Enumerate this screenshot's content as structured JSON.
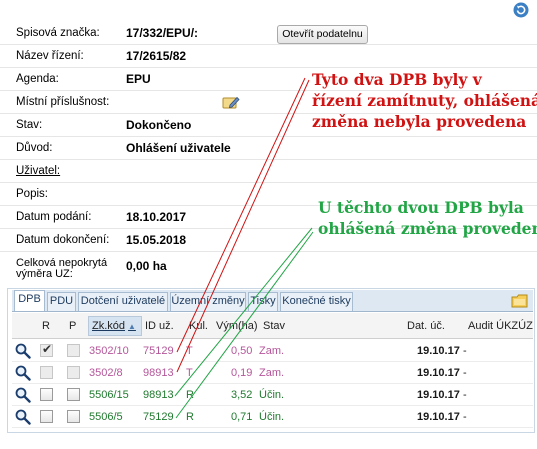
{
  "form": {
    "spisova_znacka": {
      "label": "Spisová značka:",
      "value": "17/332/EPU/:"
    },
    "open_button": "Otevřít podatelnu",
    "nazev_rizeni": {
      "label": "Název řízení:",
      "value": "17/2615/82"
    },
    "agenda": {
      "label": "Agenda:",
      "value": "EPU"
    },
    "mistni_prislusnost": {
      "label": "Místní příslušnost:",
      "value": ""
    },
    "stav": {
      "label": "Stav:",
      "value": "Dokončeno"
    },
    "duvod": {
      "label": "Důvod:",
      "value": "Ohlášení uživatele"
    },
    "uzivatel": {
      "label": "Uživatel:",
      "value": ""
    },
    "popis": {
      "label": "Popis:",
      "value": ""
    },
    "datum_podani": {
      "label": "Datum podání:",
      "value": "18.10.2017"
    },
    "datum_dokonceni": {
      "label": "Datum dokončení:",
      "value": "15.05.2018"
    },
    "vymera": {
      "label": "Celková nepokrytá výměra UZ:",
      "value": "0,00 ha"
    }
  },
  "tabs": [
    {
      "label": "DPB",
      "active": true
    },
    {
      "label": "PDU"
    },
    {
      "label": "Dotčení uživatelé"
    },
    {
      "label": "Územní změny"
    },
    {
      "label": "Tisky"
    },
    {
      "label": "Konečné tisky"
    }
  ],
  "grid": {
    "columns": {
      "r": "R",
      "p": "P",
      "zk_kod": "Zk.kód",
      "id_uz": "ID už.",
      "kul": "Kul.",
      "vym": "Vým(ha)",
      "stav": "Stav",
      "dat_uc": "Dat. úč.",
      "audit": "Audit ÚKZÚZ"
    },
    "rows": [
      {
        "r_checked": true,
        "p_checked": false,
        "disabled": true,
        "zk_kod": "3502/10",
        "id_uz": "75129",
        "kul": "T",
        "vym": "0,50",
        "stav": "Zam.",
        "dat_uc": "19.10.17",
        "audit": "-",
        "color": "#b5569b"
      },
      {
        "r_checked": false,
        "p_checked": false,
        "disabled": true,
        "zk_kod": "3502/8",
        "id_uz": "98913",
        "kul": "T",
        "vym": "0,19",
        "stav": "Zam.",
        "dat_uc": "19.10.17",
        "audit": "-",
        "color": "#b5569b"
      },
      {
        "r_checked": false,
        "p_checked": false,
        "disabled": false,
        "zk_kod": "5506/15",
        "id_uz": "98913",
        "kul": "R",
        "vym": "3,52",
        "stav": "Účin.",
        "dat_uc": "19.10.17",
        "audit": "-",
        "color": "#1f7a2e"
      },
      {
        "r_checked": false,
        "p_checked": false,
        "disabled": false,
        "zk_kod": "5506/5",
        "id_uz": "75129",
        "kul": "R",
        "vym": "0,71",
        "stav": "Účin.",
        "dat_uc": "19.10.17",
        "audit": "-",
        "color": "#1f7a2e"
      }
    ]
  },
  "annotations": {
    "red_lines": [
      "Tyto dva DPB byly v",
      "řízení zamítnuty, ohlášená",
      "změna nebyla provedena"
    ],
    "green_lines": [
      "U těchto dvou DPB byla",
      "ohlášená změna provedena"
    ],
    "red_color": "#d01212",
    "green_color": "#21a545"
  },
  "icons": {
    "refresh": "refresh-icon",
    "edit": "edit-icon",
    "folder": "folder-icon",
    "row_detail": "magnifier-icon"
  }
}
